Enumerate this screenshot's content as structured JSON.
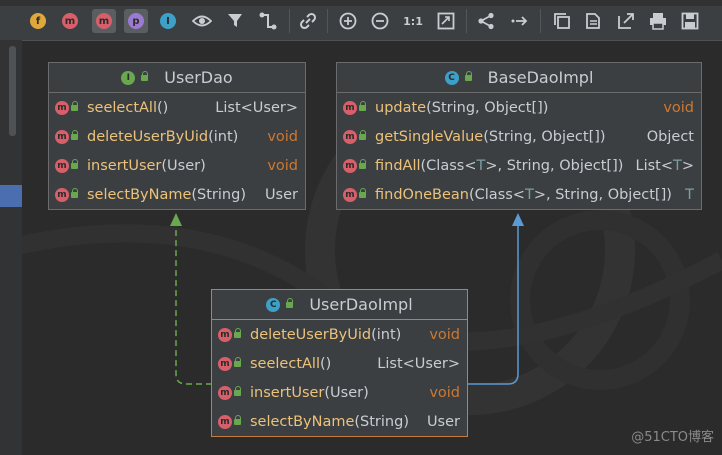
{
  "toolbar": {
    "tools": [
      {
        "name": "fields-filter",
        "glyph": "f",
        "color": "#e0a83a"
      },
      {
        "name": "methods-filter",
        "glyph": "m",
        "color": "#d65f6a"
      },
      {
        "name": "methods-visible",
        "glyph": "m",
        "color": "#d65f6a"
      },
      {
        "name": "properties-filter",
        "glyph": "p",
        "color": "#9a7bd1"
      },
      {
        "name": "inner-classes",
        "glyph": "I",
        "color": "#3da0c8"
      },
      {
        "name": "visibility-toggle",
        "glyph": "eye"
      },
      {
        "name": "filter-toggle",
        "glyph": "funnel"
      },
      {
        "name": "edge-mode",
        "glyph": "edge"
      },
      {
        "name": "link-icon",
        "glyph": "link"
      },
      {
        "name": "zoom-in",
        "glyph": "plus"
      },
      {
        "name": "zoom-out",
        "glyph": "minus"
      },
      {
        "name": "actual-size",
        "glyph": "1:1"
      },
      {
        "name": "fit-content",
        "glyph": "fit"
      },
      {
        "name": "layout",
        "glyph": "share"
      },
      {
        "name": "route-edges",
        "glyph": "route"
      },
      {
        "name": "copy-diagram",
        "glyph": "copy"
      },
      {
        "name": "export-file",
        "glyph": "export"
      },
      {
        "name": "open-in-new",
        "glyph": "open"
      },
      {
        "name": "print",
        "glyph": "print"
      },
      {
        "name": "save",
        "glyph": "save"
      }
    ]
  },
  "classes": {
    "userDao": {
      "badge": "I",
      "badge_color": "#6aa84f",
      "title": "UserDao",
      "methods": [
        {
          "name": "seelectAll",
          "params": "()",
          "ret": "List<User>",
          "ret_kw": false
        },
        {
          "name": "deleteUserByUid",
          "params": "(int)",
          "ret": "void",
          "ret_kw": true
        },
        {
          "name": "insertUser",
          "params": "(User)",
          "ret": "void",
          "ret_kw": true
        },
        {
          "name": "selectByName",
          "params": "(String)",
          "ret": "User",
          "ret_kw": false
        }
      ]
    },
    "baseDaoImpl": {
      "badge": "C",
      "badge_color": "#3da0c8",
      "title": "BaseDaoImpl",
      "methods": [
        {
          "name": "update",
          "params_pre": "(String, Object[])",
          "ret": "void",
          "ret_kw": true
        },
        {
          "name": "getSingleValue",
          "params_pre": "(String, Object[])",
          "ret": "Object",
          "ret_kw": false
        },
        {
          "name": "findAll",
          "params_pre": "(Class<",
          "gen": "T",
          "params_post": ">, String, Object[])",
          "ret_pre": "List<",
          "ret_gen": "T",
          "ret_post": ">"
        },
        {
          "name": "findOneBean",
          "params_pre": "(Class<",
          "gen": "T",
          "params_post": ">, String, Object[])",
          "ret_gen_only": "T"
        }
      ]
    },
    "userDaoImpl": {
      "badge": "C",
      "badge_color": "#3da0c8",
      "title": "UserDaoImpl",
      "methods": [
        {
          "name": "deleteUserByUid",
          "params": "(int)",
          "ret": "void",
          "ret_kw": true
        },
        {
          "name": "seelectAll",
          "params": "()",
          "ret": "List<User>",
          "ret_kw": false
        },
        {
          "name": "insertUser",
          "params": "(User)",
          "ret": "void",
          "ret_kw": true
        },
        {
          "name": "selectByName",
          "params": "(String)",
          "ret": "User",
          "ret_kw": false
        }
      ]
    }
  },
  "method_icon_glyph": "m",
  "colors": {
    "implements_edge": "#6aa84f",
    "extends_edge": "#5b9bd5",
    "selected_border": "#c77d3a",
    "method_name": "#ecc27a",
    "keyword": "#cc7832"
  },
  "watermark": "@51CTO博客"
}
